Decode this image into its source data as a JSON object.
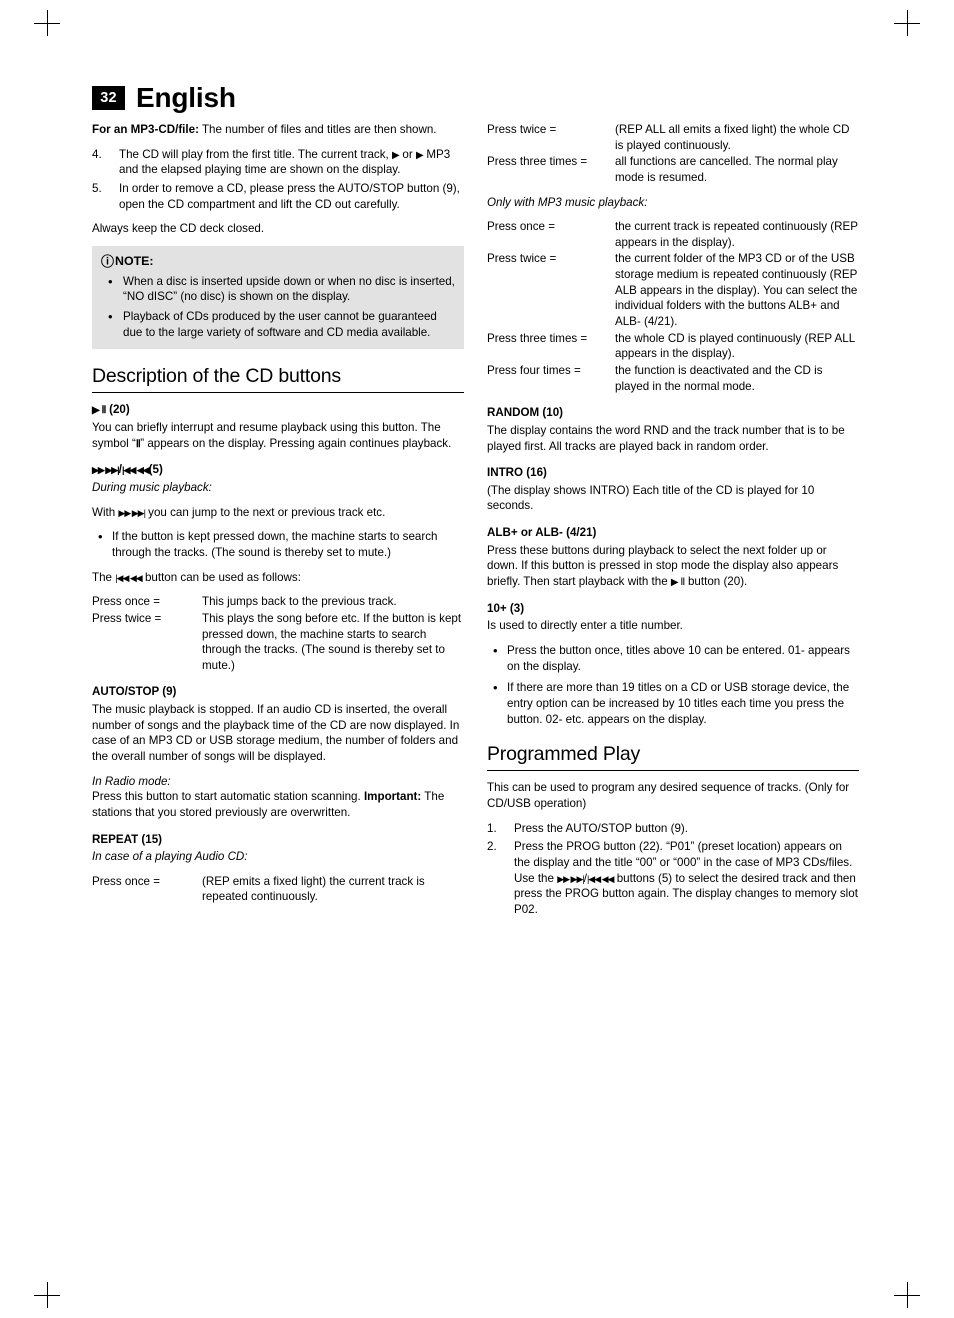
{
  "header": {
    "page_number": "32",
    "language": "English"
  },
  "left": {
    "mp3_line_bold": "For an MP3-CD/file:",
    "mp3_line_rest": " The number of files and titles are then shown.",
    "step4_num": "4.",
    "step4_text_a": "The CD will play from the first title. The current track, ",
    "step4_glyph1": "▶",
    "step4_text_b": " or ",
    "step4_glyph2": "▶",
    "step4_text_c": " MP3 and the elapsed playing time are shown on the display.",
    "step5_num": "5.",
    "step5_text": "In order to remove a CD, please press the AUTO/STOP button (9), open the CD compartment and lift the CD out carefully.",
    "always_keep": "Always keep the CD deck closed.",
    "note": {
      "icon": "info-icon",
      "title": "NOTE:",
      "bullets": [
        "When a disc is inserted upside down or when no disc is inserted, “NO dISC” (no disc) is shown on the display.",
        "Playback of CDs produced by the user cannot be guaranteed due to the large variety of software and CD media available."
      ]
    },
    "section_title": "Description of the CD buttons",
    "play_pause_head_glyph": "▶ Ⅱ",
    "play_pause_head_num": " (20)",
    "play_pause_text_a": "You can briefly interrupt  and resume playback using this button. The symbol “",
    "play_pause_text_glyph": "Ⅱ",
    "play_pause_text_b": "” appears on the display. Pressing again continues playback.",
    "skip_head": "(5)",
    "skip_during": "During music playback:",
    "skip_with_a": "With ",
    "skip_with_b": " you can jump to the next or previous track etc.",
    "skip_bullet": "If the button is kept pressed down, the machine starts to search through the tracks. (The sound is thereby set to mute.)",
    "prev_button_a": "The ",
    "prev_button_b": " button can be used as follows:",
    "prev_defs": [
      {
        "term": "Press once =",
        "desc": "This jumps back to the previous track."
      },
      {
        "term": "Press twice =",
        "desc": "This plays the song before etc. If the button is kept pressed down, the machine starts to search through the tracks. (The sound is thereby set to mute.)"
      }
    ],
    "autostop_head": "AUTO/STOP (9)",
    "autostop_text": "The music playback is stopped. If an audio CD is inserted, the overall number of songs and the playback time of the CD are now displayed. In case of an MP3 CD or USB storage medium, the number of folders and the overall number of songs will be displayed.",
    "radio_mode_italic": "In Radio mode:",
    "radio_text_a": "Press this button to start automatic station scanning. ",
    "radio_text_bold": "Important:",
    "radio_text_b": " The stations that you stored previously are overwritten.",
    "repeat_head": "REPEAT (15)",
    "repeat_italic": "In case of a playing Audio CD:",
    "repeat_defs": [
      {
        "term": "Press once =",
        "desc": "(REP emits a fixed light) the current track is repeated continuously."
      }
    ]
  },
  "right": {
    "repeat_defs_cont": [
      {
        "term": "Press twice =",
        "desc": "(REP ALL all emits a fixed light) the whole CD is played continuously."
      },
      {
        "term": "Press three times =",
        "desc": "all functions are cancelled. The normal play mode is resumed."
      }
    ],
    "only_mp3_italic": "Only with MP3 music playback:",
    "mp3_defs": [
      {
        "term": "Press once =",
        "desc": "the current track is repeated continuously (REP appears in the display)."
      },
      {
        "term": "Press twice =",
        "desc": "the current folder of the MP3 CD or of the USB storage medium is repeated continuously (REP ALB appears in the display). You can select the individual folders with the buttons ALB+ and ALB- (4/21)."
      },
      {
        "term": "Press three times =",
        "desc": "the whole CD is played continuously (REP ALL appears in the display)."
      },
      {
        "term": "Press four times =",
        "desc": "the function is deactivated and the CD is played in the normal mode."
      }
    ],
    "random_head": "RANDOM (10)",
    "random_text": "The display contains the word RND and the track number that is to be played first. All tracks are played back in random order.",
    "intro_head": "INTRO (16)",
    "intro_text": "(The display shows INTRO) Each title of the CD is played for 10 seconds.",
    "alb_head": "ALB+ or ALB- (4/21)",
    "alb_text_a": "Press these buttons during playback to select the next folder up or down. If this button is pressed in stop mode the display also appears briefly. Then start playback with the ",
    "alb_glyph": "▶ Ⅱ",
    "alb_text_b": " button (20).",
    "ten_plus_head": "10+ (3)",
    "ten_plus_text": "Is used to directly enter a title number.",
    "ten_plus_bullets": [
      "Press the button once, titles above 10 can be entered. 01- appears on the display.",
      "If there are more than 19 titles on a CD or USB storage device, the entry option can be increased by 10 titles each time you press the button. 02- etc. appears on the display."
    ],
    "programmed_title": "Programmed Play",
    "programmed_intro": "This can be used to program any desired sequence of tracks. (Only for CD/USB operation)",
    "prog_step1_num": "1.",
    "prog_step1_text": "Press the AUTO/STOP button (9).",
    "prog_step2_num": "2.",
    "prog_step2_a": "Press the PROG button (22). “P01” (preset location) appears on the display and the title “00” or “000” in the case of MP3 CDs/files. Use the ",
    "prog_step2_b": " buttons (5) to select the desired track and then press the PROG button again. The display changes to memory slot P02."
  }
}
